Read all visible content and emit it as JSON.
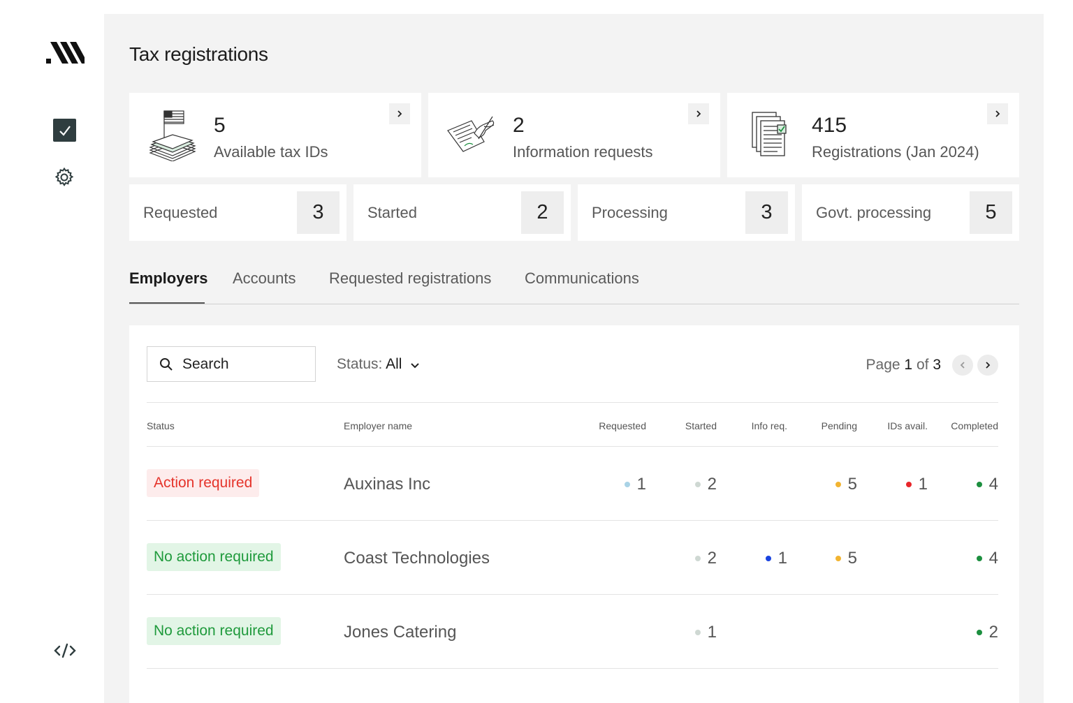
{
  "page": {
    "title": "Tax registrations"
  },
  "sidebar": {
    "logo": "logo-icon",
    "items": [
      {
        "name": "tasks",
        "icon": "checkbox-icon",
        "active": true
      },
      {
        "name": "settings",
        "icon": "gear-icon"
      },
      {
        "name": "developer",
        "icon": "code-icon"
      }
    ]
  },
  "cards": [
    {
      "number": "5",
      "label": "Available tax IDs",
      "illustration": "flag-documents-illustration"
    },
    {
      "number": "2",
      "label": "Information requests",
      "illustration": "hand-signing-illustration"
    },
    {
      "number": "415",
      "label": "Registrations (Jan 2024)",
      "illustration": "documents-check-illustration"
    }
  ],
  "stats": [
    {
      "label": "Requested",
      "value": "3"
    },
    {
      "label": "Started",
      "value": "2"
    },
    {
      "label": "Processing",
      "value": "3"
    },
    {
      "label": "Govt. processing",
      "value": "5"
    }
  ],
  "tabs": [
    {
      "label": "Employers",
      "active": true
    },
    {
      "label": "Accounts"
    },
    {
      "label": "Requested registrations"
    },
    {
      "label": "Communications"
    }
  ],
  "toolbar": {
    "search_label": "Search",
    "status_prefix": "Status:",
    "status_value": "All",
    "page_prefix": "Page",
    "page_current": "1",
    "page_of": "of",
    "page_total": "3"
  },
  "table": {
    "headers": {
      "status": "Status",
      "employer": "Employer name",
      "requested": "Requested",
      "started": "Started",
      "info_req": "Info req.",
      "pending": "Pending",
      "ids_avail": "IDs avail.",
      "completed": "Completed"
    },
    "rows": [
      {
        "status": "Action required",
        "status_type": "red",
        "employer": "Auxinas Inc",
        "requested": "1",
        "started": "2",
        "info_req": "",
        "pending": "5",
        "ids_avail": "1",
        "completed": "4"
      },
      {
        "status": "No action required",
        "status_type": "green",
        "employer": "Coast Technologies",
        "requested": "",
        "started": "2",
        "info_req": "1",
        "pending": "5",
        "ids_avail": "",
        "completed": "4"
      },
      {
        "status": "No action required",
        "status_type": "green",
        "employer": "Jones Catering",
        "requested": "",
        "started": "1",
        "info_req": "",
        "pending": "",
        "ids_avail": "",
        "completed": "2"
      }
    ]
  },
  "colors": {
    "requested": "#a9d3e6",
    "started": "#cfd8d3",
    "info_req": "#1a44e0",
    "pending": "#f2b431",
    "ids_avail": "#e8262a",
    "completed": "#1c8f3f",
    "sidebar_active": "#2f3d3f"
  }
}
